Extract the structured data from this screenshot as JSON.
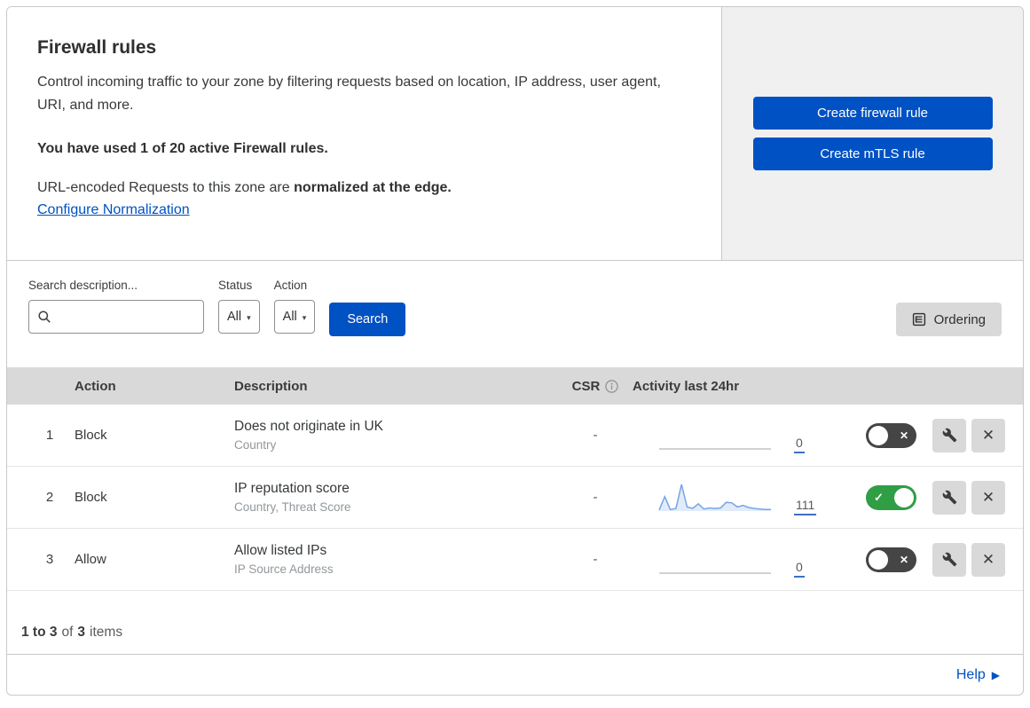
{
  "header": {
    "title": "Firewall rules",
    "description": "Control incoming traffic to your zone by filtering requests based on location, IP address, user agent, URI, and more.",
    "usage_note": "You have used 1 of 20 active Firewall rules.",
    "normalization_text": "URL-encoded Requests to this zone are",
    "normalization_bold": "normalized at the edge.",
    "normalization_link": "Configure Normalization",
    "create_firewall_button": "Create firewall rule",
    "create_mtls_button": "Create mTLS rule"
  },
  "filters": {
    "search_label": "Search description...",
    "search_value": "",
    "status_label": "Status",
    "status_value": "All",
    "action_label": "Action",
    "action_value": "All",
    "search_button": "Search",
    "ordering_button": "Ordering"
  },
  "table": {
    "columns": {
      "action": "Action",
      "description": "Description",
      "csr": "CSR",
      "activity": "Activity last 24hr"
    },
    "rows": [
      {
        "number": "1",
        "action": "Block",
        "description": "Does not originate in UK",
        "fields": "Country",
        "csr": "-",
        "activity_count": "0",
        "enabled": false,
        "sparkline": null
      },
      {
        "number": "2",
        "action": "Block",
        "description": "IP reputation score",
        "fields": "Country, Threat Score",
        "csr": "-",
        "activity_count": "111",
        "enabled": true,
        "sparkline": [
          2,
          28,
          3,
          5,
          52,
          8,
          5,
          14,
          4,
          6,
          5,
          6,
          17,
          16,
          8,
          11,
          7,
          5,
          4,
          3,
          3
        ]
      },
      {
        "number": "3",
        "action": "Allow",
        "description": "Allow listed IPs",
        "fields": "IP Source Address",
        "csr": "-",
        "activity_count": "0",
        "enabled": false,
        "sparkline": null
      }
    ]
  },
  "footer": {
    "range_bold": "1 to 3",
    "of_text": "of",
    "total_bold": "3",
    "items_text": "items",
    "help_label": "Help"
  },
  "icons": {
    "dropdown_caret": "▾",
    "toggle_check": "✓",
    "toggle_x": "✕",
    "close_x": "✕",
    "help_arrow": "▶"
  },
  "colors": {
    "primary_blue": "#0051c3",
    "link_blue": "#0051c3",
    "toggle_on_green": "#2f9e44",
    "toggle_off_gray": "#454545",
    "panel_gray": "#f0f0f0",
    "table_header_gray": "#d9d9d9",
    "sparkline_blue": "#76a5e3"
  }
}
